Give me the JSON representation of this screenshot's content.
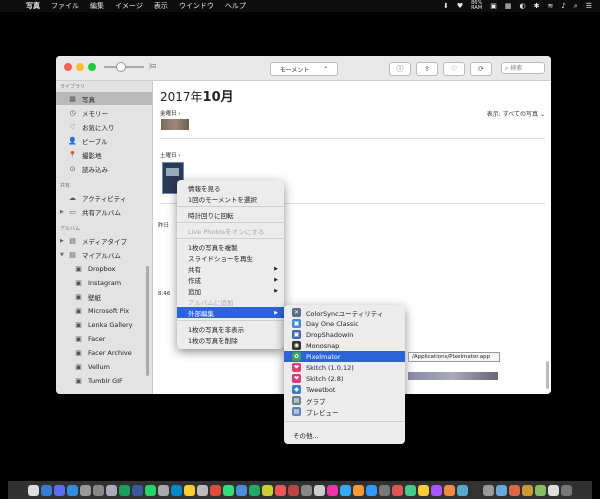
{
  "menubar": {
    "apple": "",
    "items": [
      "写真",
      "ファイル",
      "編集",
      "イメージ",
      "表示",
      "ウインドウ",
      "ヘルプ"
    ],
    "status_icons": [
      "⬇",
      "♥",
      "▣",
      "▦",
      "◐",
      "✱",
      "≋",
      "♪"
    ],
    "battery_pct": "86%",
    "battery_label": "RAM",
    "status_right": [
      "⌕",
      "☰"
    ]
  },
  "window": {
    "traffic_colors": [
      "#fc5f57",
      "#fdbd2e",
      "#28c840"
    ],
    "zoom_end": "|⊟",
    "segment_label": "モーメント",
    "segment_arrow": "⌃",
    "toolbar_icons": [
      "ⓘ",
      "⇪",
      "♡",
      "⟳"
    ],
    "search_placeholder": "⌕ 検索"
  },
  "sidebar": {
    "library_header": "ライブラリ",
    "library_items": [
      {
        "icon": "▦",
        "label": "写真"
      },
      {
        "icon": "◷",
        "label": "メモリー"
      },
      {
        "icon": "♡",
        "label": "お気に入り"
      },
      {
        "icon": "👤",
        "label": "ピープル"
      },
      {
        "icon": "📍",
        "label": "撮影地"
      },
      {
        "icon": "⊙",
        "label": "読み込み"
      }
    ],
    "shared_header": "共有",
    "shared_items": [
      {
        "icon": "☁",
        "label": "アクティビティ"
      },
      {
        "icon": "▭",
        "label": "共有アルバム"
      }
    ],
    "album_header": "アルバム",
    "album_items": [
      {
        "icon": "▤",
        "label": "メディアタイプ"
      },
      {
        "icon": "▤",
        "label": "マイアルバム"
      },
      {
        "icon": "▣",
        "label": "Dropbox"
      },
      {
        "icon": "▣",
        "label": "Instagram"
      },
      {
        "icon": "▣",
        "label": "壁紙"
      },
      {
        "icon": "▣",
        "label": "Microsoft Pix"
      },
      {
        "icon": "▣",
        "label": "Lenka Gallery"
      },
      {
        "icon": "▣",
        "label": "Facer"
      },
      {
        "icon": "▣",
        "label": "Facer Archive"
      },
      {
        "icon": "▣",
        "label": "Vellum"
      },
      {
        "icon": "▣",
        "label": "Tumblr GIF"
      }
    ],
    "disclosure": "▶",
    "disclosure_open": "▼"
  },
  "main": {
    "year": "2017年",
    "month": "10月",
    "show_label": "表示: すべての写真 ⌄",
    "day1": "金曜日 ›",
    "day2": "土曜日 ›",
    "side_label1": "昨日",
    "side_label2": "8:46"
  },
  "context_menu": {
    "items": [
      {
        "label": "情報を見る"
      },
      {
        "label": "1回のモーメントを選択"
      },
      {
        "label": "時計回りに回転"
      },
      {
        "label": "Live Photosをオンにする",
        "disabled": true
      },
      {
        "label": "1枚の写真を複製"
      },
      {
        "label": "スライドショーを再生"
      },
      {
        "label": "共有",
        "submenu": true
      },
      {
        "label": "作成",
        "submenu": true
      },
      {
        "label": "追加",
        "submenu": true
      },
      {
        "label": "アルバムに追加",
        "disabled": true
      },
      {
        "label": "外部編集",
        "submenu": true,
        "highlight": true
      },
      {
        "label": "1枚の写真を非表示"
      },
      {
        "label": "1枚の写真を削除"
      }
    ],
    "submenu_arrow": "▶"
  },
  "submenu": {
    "items": [
      {
        "label": "ColorSyncユーティリティ",
        "icon": "✕",
        "color": "#5a6f8c"
      },
      {
        "label": "Day One Classic",
        "icon": "▣",
        "color": "#3b8bd8"
      },
      {
        "label": "DropShadowIn",
        "icon": "▣",
        "color": "#4a66aa"
      },
      {
        "label": "Monosnap",
        "icon": "◉",
        "color": "#333333"
      },
      {
        "label": "Pixelmator",
        "icon": "✿",
        "color": "#3a9d6a",
        "highlight": true
      },
      {
        "label": "Skitch (1.0.12)",
        "icon": "❤",
        "color": "#e04070"
      },
      {
        "label": "Skitch (2.8)",
        "icon": "❤",
        "color": "#d93b7a"
      },
      {
        "label": "Tweetbot",
        "icon": "◆",
        "color": "#3d7fc4"
      },
      {
        "label": "グラブ",
        "icon": "▤",
        "color": "#6f7c8a"
      },
      {
        "label": "プレビュー",
        "icon": "▤",
        "color": "#5f86b8"
      },
      {
        "label": "その他..."
      }
    ]
  },
  "tooltip": "/Applications/Pixelmator.app",
  "dock": {
    "colors": [
      "#ddd",
      "#3a7bd5",
      "#5b6cf0",
      "#2f8ee0",
      "#999",
      "#888",
      "#aab",
      "#1a9e5a",
      "#3b5998",
      "#25d366",
      "#aaa",
      "#0088cc",
      "#ffcc33",
      "#bbb",
      "#e04a3a",
      "#3d7",
      "#4a90d9",
      "#2a6",
      "#cc3",
      "#e55",
      "#b44",
      "#888",
      "#ccc",
      "#e3a",
      "#3af",
      "#f93",
      "#39f",
      "#777",
      "#d55",
      "#4c8",
      "#fc3",
      "#a5f",
      "#e84",
      "#5ac",
      "#333",
      "#999",
      "#6ad",
      "#d64",
      "#c93",
      "#8b6",
      "#ddd",
      "#777"
    ]
  }
}
